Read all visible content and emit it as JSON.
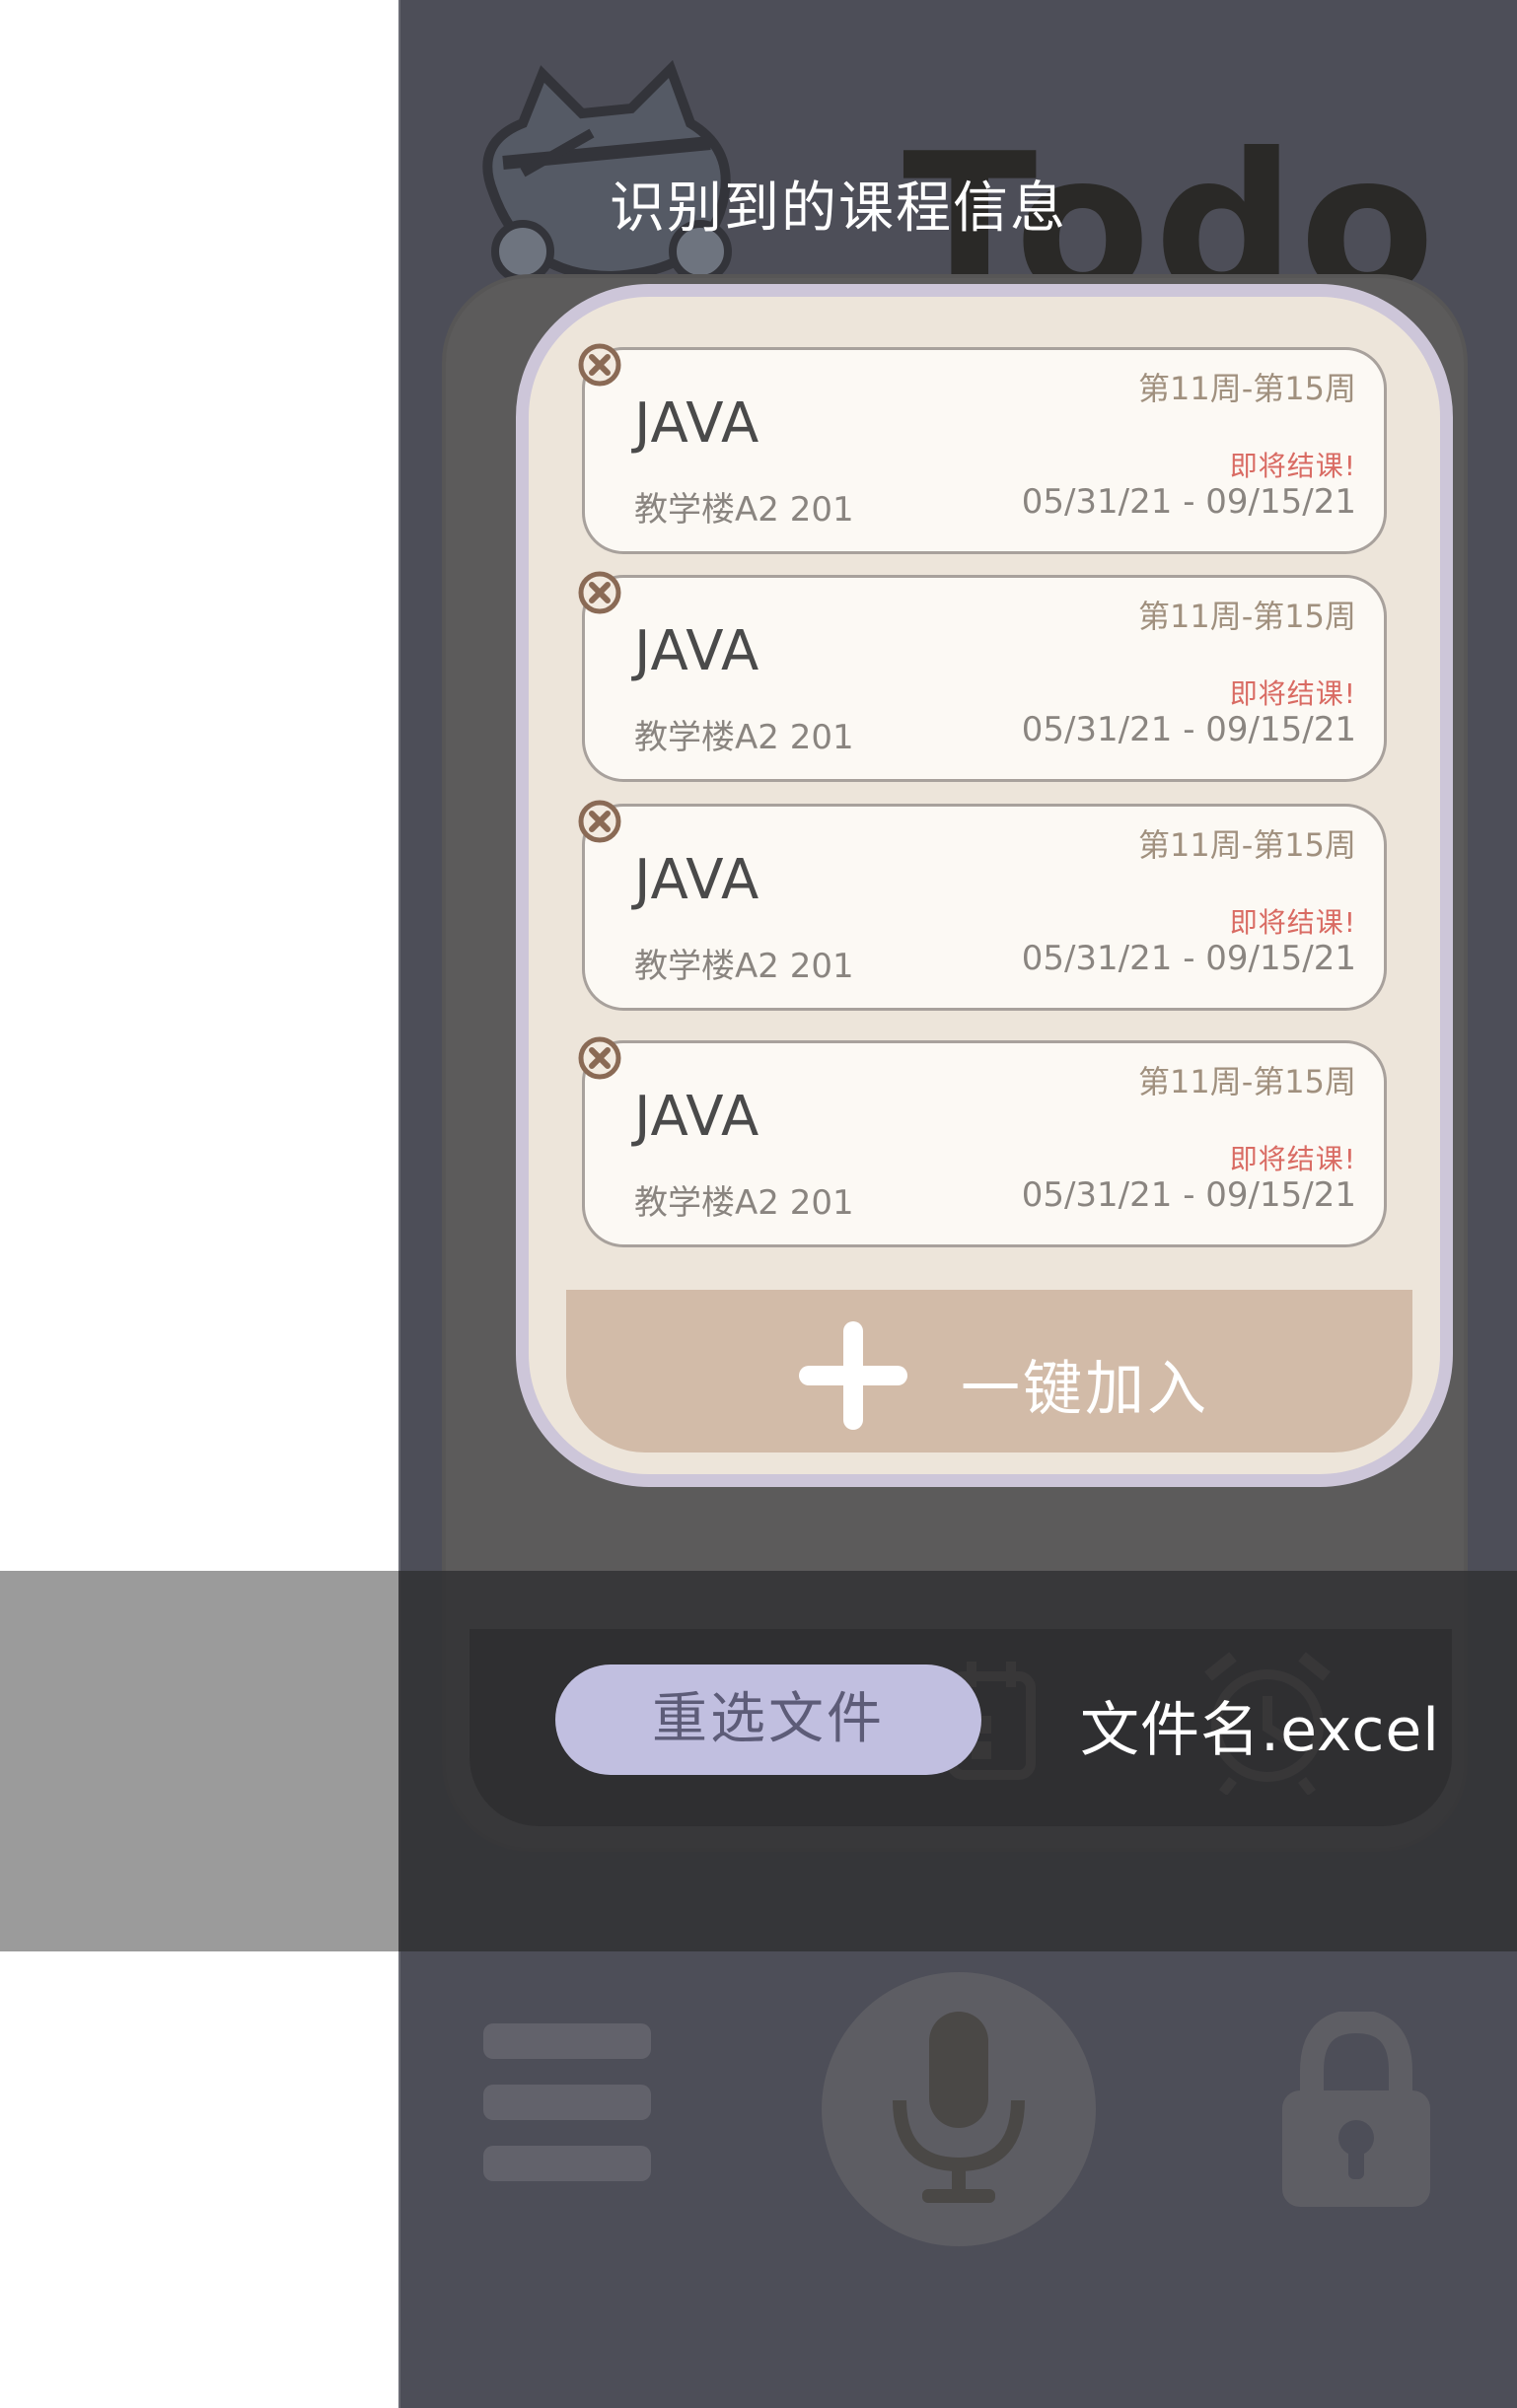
{
  "app": {
    "brand_wordmark": "Todo"
  },
  "modal": {
    "title": "识别到的课程信息",
    "courses": [
      {
        "weeks": "第11周-第15周",
        "name": "JAVA",
        "warning": "即将结课!",
        "location": "教学楼A2 201",
        "dates": "05/31/21 - 09/15/21"
      },
      {
        "weeks": "第11周-第15周",
        "name": "JAVA",
        "warning": "即将结课!",
        "location": "教学楼A2 201",
        "dates": "05/31/21 - 09/15/21"
      },
      {
        "weeks": "第11周-第15周",
        "name": "JAVA",
        "warning": "即将结课!",
        "location": "教学楼A2 201",
        "dates": "05/31/21 - 09/15/21"
      },
      {
        "weeks": "第11周-第15周",
        "name": "JAVA",
        "warning": "即将结课!",
        "location": "教学楼A2 201",
        "dates": "05/31/21 - 09/15/21"
      }
    ],
    "add_all_label": "一键加入"
  },
  "file": {
    "reselect_label": "重选文件",
    "filename": "文件名.excel"
  },
  "icons": {
    "close": "close-icon",
    "plus": "plus-icon",
    "menu": "menu-icon",
    "mic": "microphone-icon",
    "lock": "lock-icon",
    "calendar": "calendar-icon",
    "alarm": "alarm-clock-icon"
  },
  "colors": {
    "phone_bg": "#4d4e58",
    "modal_border": "#cdc6d9",
    "modal_fill": "#ede5da",
    "card_fill": "#fcf9f4",
    "add_button": "#d2bba8",
    "reselect_button": "#c1bfe0",
    "warning": "#d96b63",
    "close_badge": "#8a6a55"
  }
}
